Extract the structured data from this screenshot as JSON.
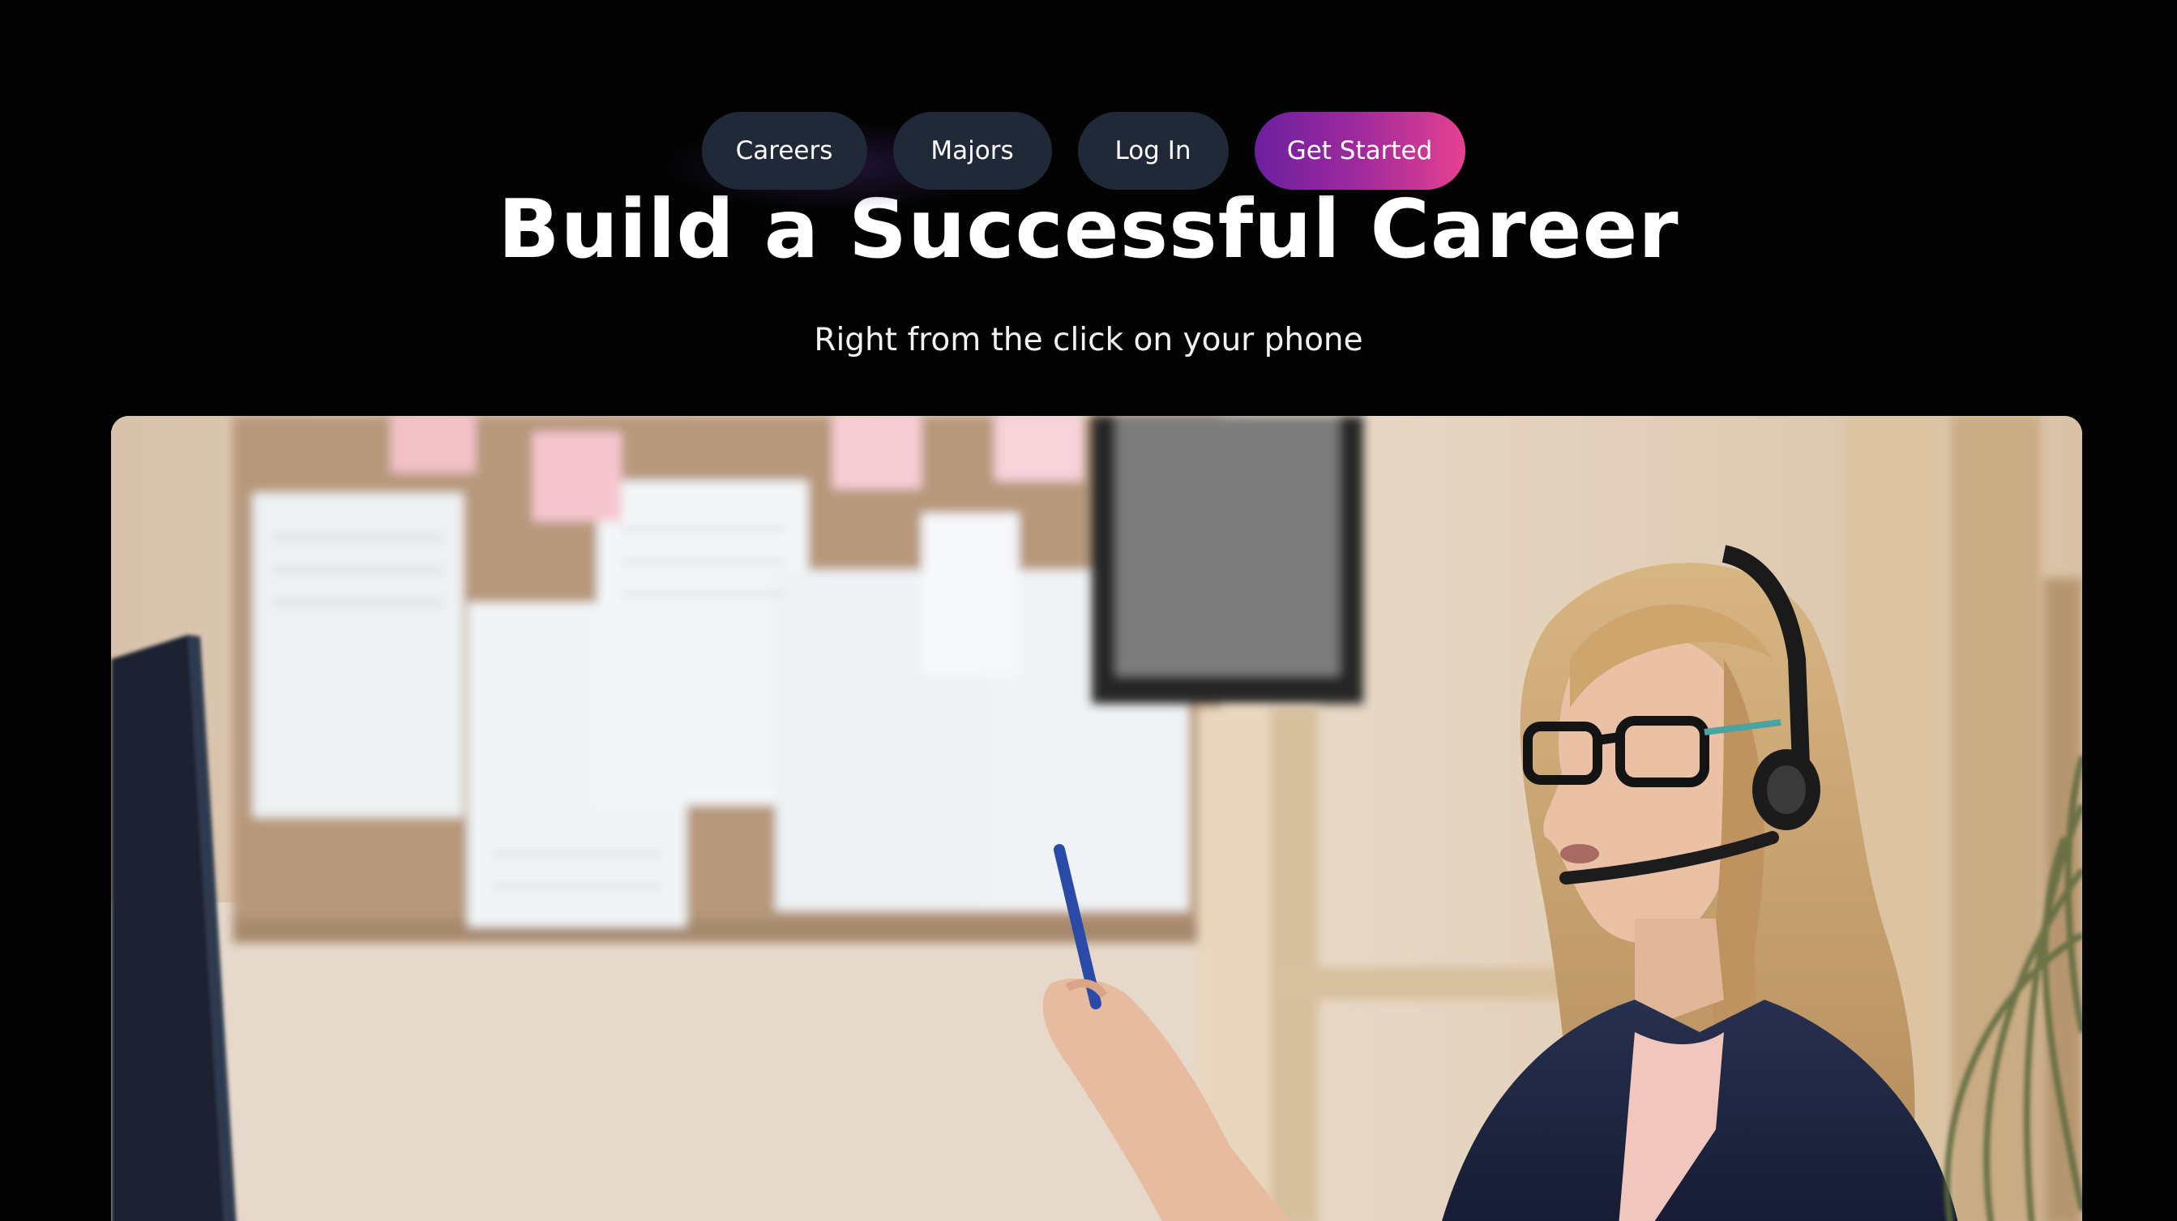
{
  "nav": {
    "careers_label": "Careers",
    "majors_label": "Majors",
    "login_label": "Log In",
    "cta_label": "Get Started"
  },
  "hero": {
    "title": "Build a Successful Career",
    "subtitle": "Right from the click on your phone",
    "media_icon": "video-thumbnail-office-headset"
  },
  "colors": {
    "background": "#030303",
    "nav_button": "#1f2937",
    "cta_gradient_start": "#6b1fa0",
    "cta_gradient_end": "#e64190",
    "text": "#ffffff"
  }
}
